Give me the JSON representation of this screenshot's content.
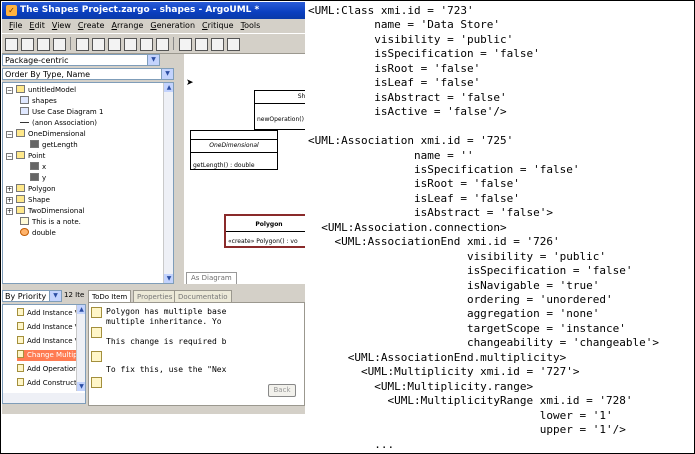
{
  "window": {
    "title": "The Shapes Project.zargo - shapes - ArgoUML *",
    "menu": [
      "File",
      "Edit",
      "View",
      "Create",
      "Arrange",
      "Generation",
      "Critique",
      "Tools"
    ]
  },
  "explorer": {
    "perspective": "Package-centric",
    "order": "Order By Type, Name",
    "tree": [
      {
        "label": "untitledModel",
        "expander": "−"
      },
      {
        "label": "shapes",
        "expander": ""
      },
      {
        "label": "Use Case Diagram 1",
        "expander": ""
      },
      {
        "label": "(anon Association)",
        "expander": ""
      },
      {
        "label": "OneDimensional",
        "expander": "−"
      },
      {
        "label": "getLength",
        "expander": ""
      },
      {
        "label": "Point",
        "expander": "−"
      },
      {
        "label": "x",
        "expander": ""
      },
      {
        "label": "y",
        "expander": ""
      },
      {
        "label": "Polygon",
        "expander": "+"
      },
      {
        "label": "Shape",
        "expander": "+"
      },
      {
        "label": "TwoDimensional",
        "expander": "+"
      },
      {
        "label": "This is a note.",
        "expander": ""
      },
      {
        "label": "double",
        "expander": ""
      }
    ]
  },
  "diagram": {
    "class_top_name": "Sha",
    "class_top_op": "newOperation()",
    "class_one_name": "OneDimensional",
    "class_one_op": "getLength() : double",
    "class_poly_name": "Polygon",
    "class_poly_op": "«create» Polygon() : vo",
    "tab": "As Diagram"
  },
  "todo": {
    "filter": "By Priority",
    "count": "12 Ite",
    "items": [
      {
        "label": "Add Instance Vari",
        "selected": false
      },
      {
        "label": "Add Instance Vari",
        "selected": false
      },
      {
        "label": "Add Instance Vari",
        "selected": false
      },
      {
        "label": "Change Multiple In",
        "selected": true
      },
      {
        "label": "Add Operations to",
        "selected": false
      },
      {
        "label": "Add Constructor t",
        "selected": false
      }
    ]
  },
  "details": {
    "tabs": [
      "ToDo Item",
      "Properties",
      "Documentatio"
    ],
    "lines": [
      "Polygon has multiple base",
      "multiple inheritance.  Yo",
      "",
      "This change is required b",
      "",
      "To fix this, use the \"Nex"
    ],
    "back_label": "Back"
  },
  "code": {
    "lines": [
      "<UML:Class xmi.id = '723'",
      "          name = 'Data Store'",
      "          visibility = 'public'",
      "          isSpecification = 'false'",
      "          isRoot = 'false'",
      "          isLeaf = 'false'",
      "          isAbstract = 'false'",
      "          isActive = 'false'/>",
      "",
      "<UML:Association xmi.id = '725'",
      "                name = ''",
      "                isSpecification = 'false'",
      "                isRoot = 'false'",
      "                isLeaf = 'false'",
      "                isAbstract = 'false'>",
      "  <UML:Association.connection>",
      "    <UML:AssociationEnd xmi.id = '726'",
      "                        visibility = 'public'",
      "                        isSpecification = 'false'",
      "                        isNavigable = 'true'",
      "                        ordering = 'unordered'",
      "                        aggregation = 'none'",
      "                        targetScope = 'instance'",
      "                        changeability = 'changeable'>",
      "      <UML:AssociationEnd.multiplicity>",
      "        <UML:Multiplicity xmi.id = '727'>",
      "          <UML:Multiplicity.range>",
      "            <UML:MultiplicityRange xmi.id = '728'",
      "                                   lower = '1'",
      "                                   upper = '1'/>",
      "          ..."
    ]
  }
}
